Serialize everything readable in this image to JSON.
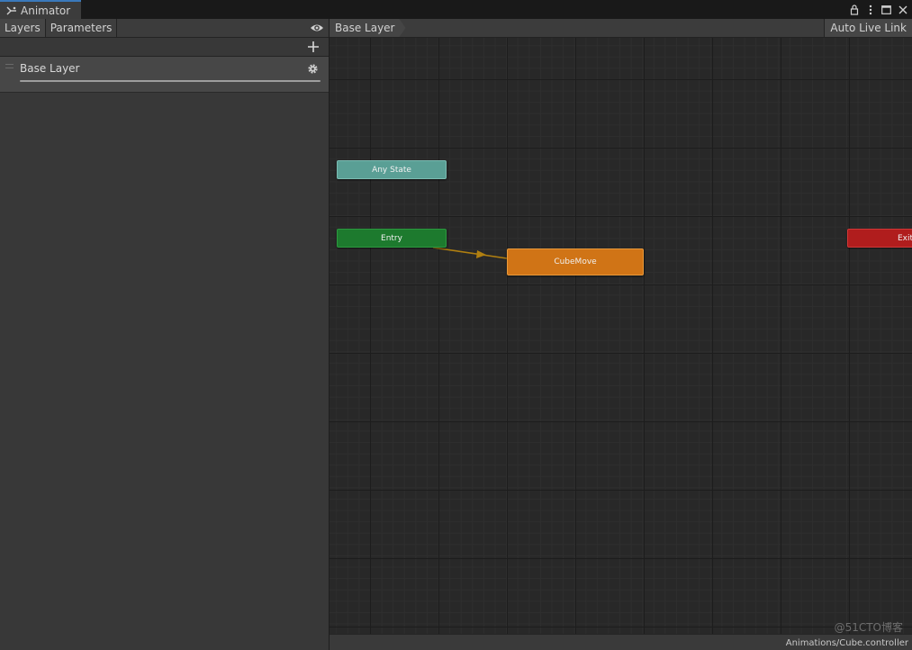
{
  "window": {
    "tab_title": "Animator",
    "accent": "#3a79bb"
  },
  "left_panel": {
    "tabs": [
      {
        "label": "Layers",
        "active": true
      },
      {
        "label": "Parameters",
        "active": false
      }
    ],
    "layers": [
      {
        "name": "Base Layer"
      }
    ]
  },
  "graph": {
    "breadcrumb": "Base Layer",
    "live_link_label": "Auto Live Link",
    "states": {
      "any_state": {
        "label": "Any State",
        "color": "#5a9f95"
      },
      "entry": {
        "label": "Entry",
        "color": "#1d7a2e"
      },
      "default_state": {
        "label": "CubeMove",
        "color": "#d07416"
      },
      "exit": {
        "label": "Exit",
        "color": "#b01d1d"
      }
    },
    "transition_color": "#b07f10"
  },
  "status": {
    "asset_path": "Animations/Cube.controller",
    "watermark": "@51CTO博客"
  }
}
